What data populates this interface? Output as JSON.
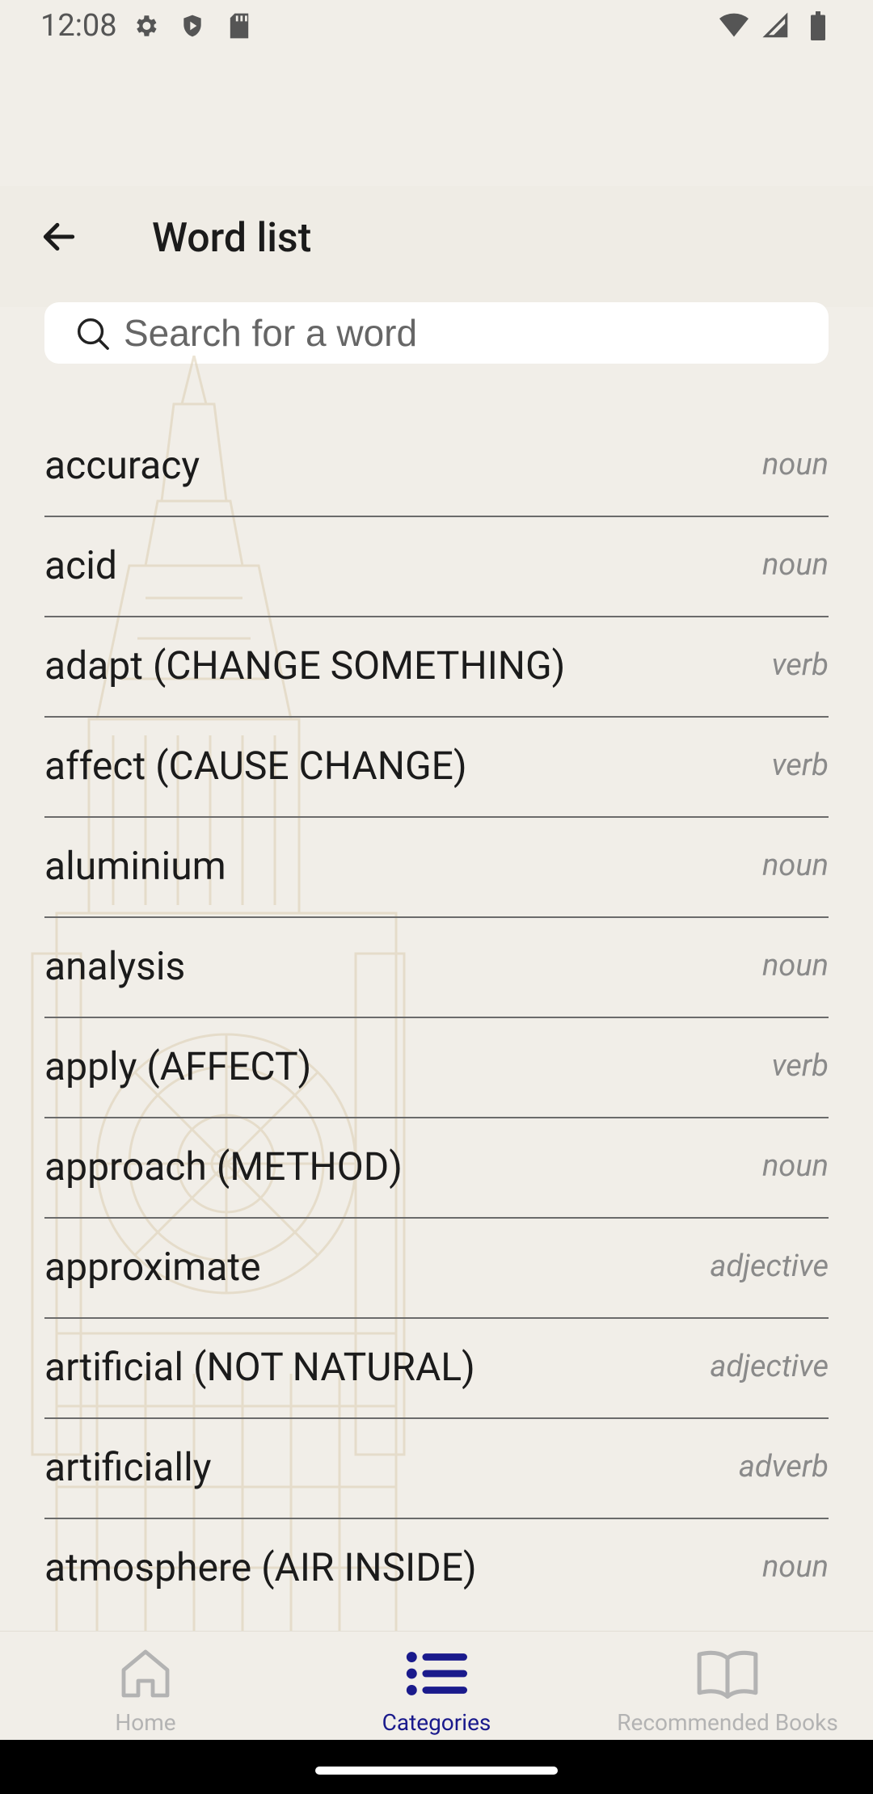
{
  "status_bar": {
    "time": "12:08",
    "left_icons": [
      "gear-icon",
      "shield-icon",
      "sd-card-icon"
    ],
    "right_icons": [
      "wifi-icon",
      "signal-icon",
      "battery-icon"
    ]
  },
  "app_bar": {
    "title": "Word list",
    "back_icon": "back-arrow-icon"
  },
  "search": {
    "placeholder": "Search for a word",
    "value": ""
  },
  "words": [
    {
      "word": "accuracy",
      "pos": "noun"
    },
    {
      "word": "acid",
      "pos": "noun"
    },
    {
      "word": "adapt (CHANGE SOMETHING)",
      "pos": "verb"
    },
    {
      "word": "affect (CAUSE CHANGE)",
      "pos": "verb"
    },
    {
      "word": "aluminium",
      "pos": "noun"
    },
    {
      "word": "analysis",
      "pos": "noun"
    },
    {
      "word": "apply (AFFECT)",
      "pos": "verb"
    },
    {
      "word": "approach (METHOD)",
      "pos": "noun"
    },
    {
      "word": "approximate",
      "pos": "adjective"
    },
    {
      "word": "artificial (NOT NATURAL)",
      "pos": "adjective"
    },
    {
      "word": "artificially",
      "pos": "adverb"
    },
    {
      "word": "atmosphere (AIR INSIDE)",
      "pos": "noun"
    }
  ],
  "bottom_nav": {
    "items": [
      {
        "label": "Home",
        "icon": "home-icon",
        "active": false
      },
      {
        "label": "Categories",
        "icon": "list-icon",
        "active": true
      },
      {
        "label": "Recommended Books",
        "icon": "book-icon",
        "active": false
      }
    ]
  },
  "colors": {
    "background": "#f1eee8",
    "active_nav": "#1a1a8c",
    "inactive_nav": "#b3b3b3",
    "part_of_speech": "#8a8a8a"
  }
}
